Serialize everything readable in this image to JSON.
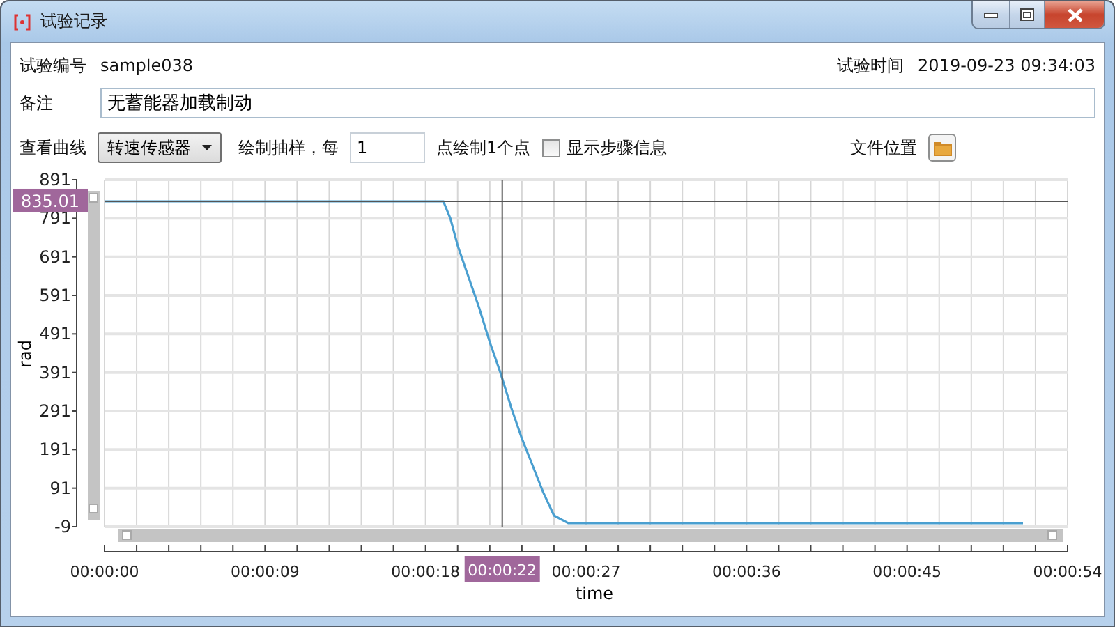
{
  "window": {
    "title": "试验记录"
  },
  "info": {
    "id_label": "试验编号",
    "id_value": "sample038",
    "time_label": "试验时间",
    "time_value": "2019-09-23 09:34:03"
  },
  "remark": {
    "label": "备注",
    "value": "无蓄能器加载制动"
  },
  "controls": {
    "curve_label": "查看曲线",
    "curve_value": "转速传感器",
    "sample_prefix": "绘制抽样，每",
    "sample_value": "1",
    "sample_suffix": "点绘制1个点",
    "show_steps": {
      "label": "显示步骤信息",
      "checked": false
    },
    "file_label": "文件位置"
  },
  "chart": {
    "chart_data": {
      "type": "line",
      "xlabel": "time",
      "ylabel": "rad",
      "xlim": [
        0,
        54
      ],
      "ylim": [
        -9,
        891
      ],
      "x": [
        0,
        19,
        19.4,
        19.8,
        20.4,
        21,
        21.6,
        22.2,
        22.8,
        23.4,
        24,
        24.6,
        25.2,
        26,
        51.5
      ],
      "series": [
        {
          "color": "#4a9fd0",
          "values": [
            835,
            835,
            790,
            720,
            640,
            560,
            470,
            390,
            300,
            220,
            150,
            80,
            20,
            0,
            0
          ]
        }
      ],
      "xticks": [
        {
          "value": 0,
          "label": "00:00:00"
        },
        {
          "value": 9,
          "label": "00:00:09"
        },
        {
          "value": 18,
          "label": "00:00:18"
        },
        {
          "value": 27,
          "label": "00:00:27"
        },
        {
          "value": 36,
          "label": "00:00:36"
        },
        {
          "value": 45,
          "label": "00:00:45"
        },
        {
          "value": 54,
          "label": "00:00:54"
        }
      ],
      "yticks": [
        -9,
        91,
        191,
        291,
        391,
        491,
        591,
        691,
        791,
        891
      ],
      "grid": true,
      "ref_lines": [
        {
          "axis": "y",
          "value": 835.01,
          "label": "835.01"
        },
        {
          "axis": "x",
          "value": 22.3,
          "label": "00:00:22"
        }
      ]
    }
  }
}
